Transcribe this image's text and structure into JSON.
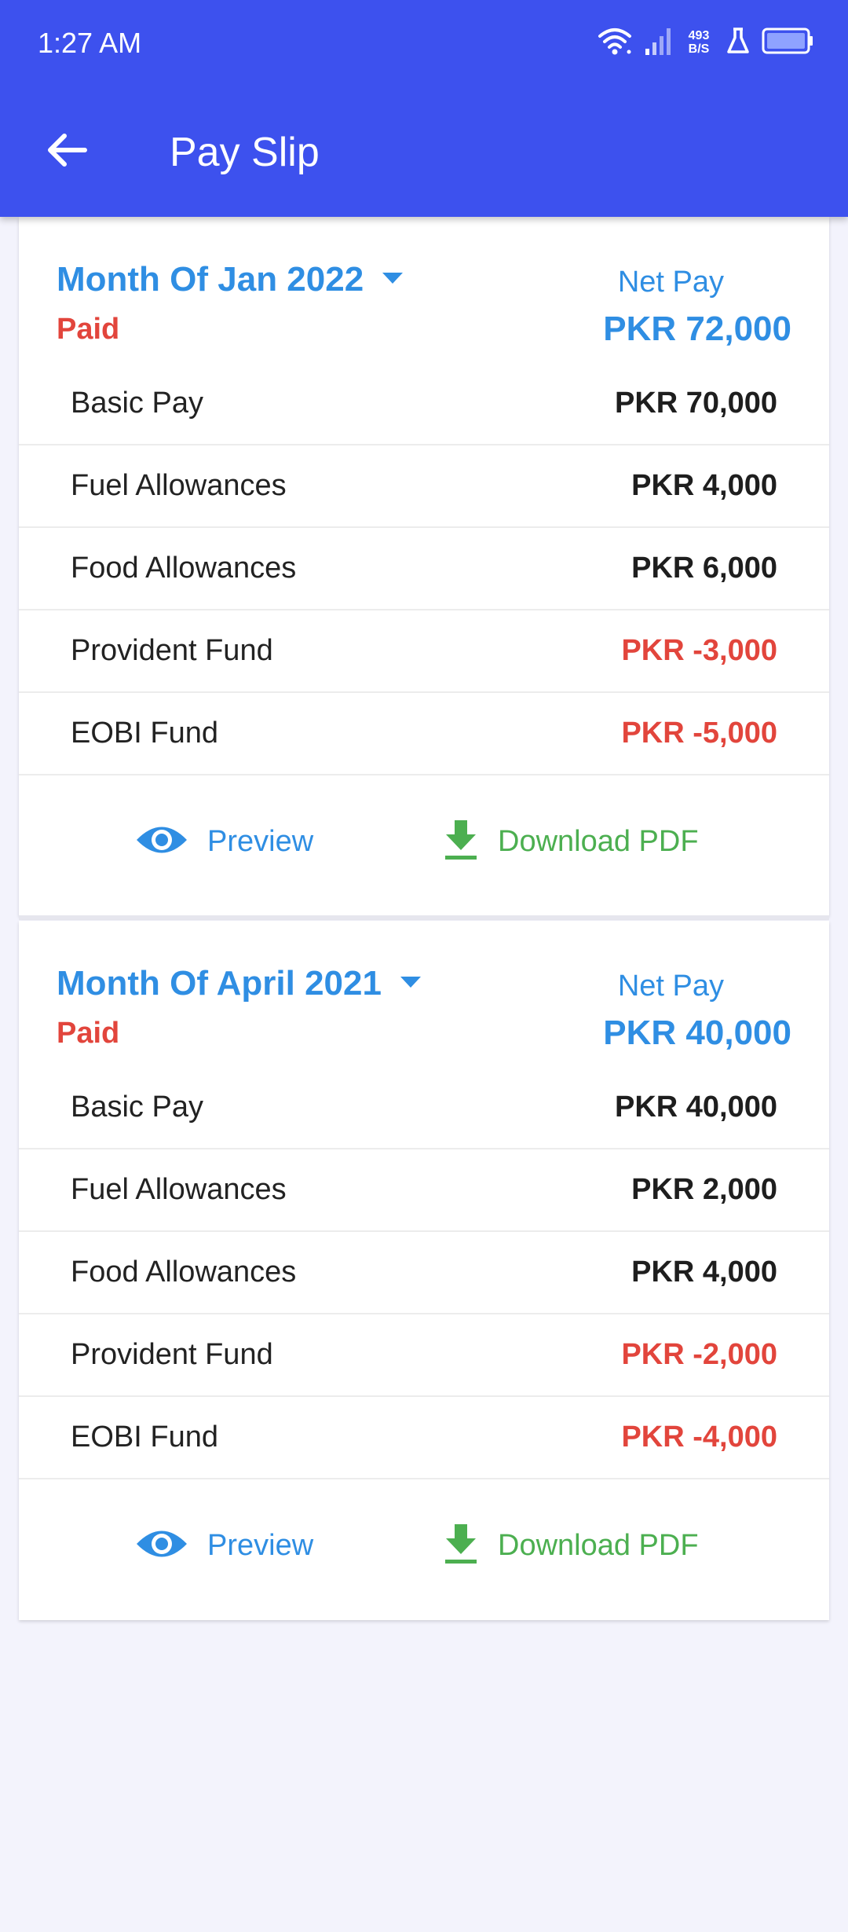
{
  "status_bar": {
    "time": "1:27 AM",
    "net_speed_value": "493",
    "net_speed_unit": "B/S"
  },
  "app_bar": {
    "title": "Pay Slip"
  },
  "payslips": [
    {
      "month": "Month Of Jan 2022",
      "status": "Paid",
      "net_pay_label": "Net Pay",
      "net_pay_value": "PKR 72,000",
      "items": [
        {
          "label": "Basic Pay",
          "value": "PKR 70,000"
        },
        {
          "label": "Fuel Allowances",
          "value": "PKR 4,000"
        },
        {
          "label": "Food Allowances",
          "value": "PKR 6,000"
        },
        {
          "label": "Provident Fund",
          "value": "PKR -3,000"
        },
        {
          "label": "EOBI Fund",
          "value": "PKR -5,000"
        }
      ],
      "preview_label": "Preview",
      "download_label": "Download PDF"
    },
    {
      "month": "Month Of April 2021",
      "status": "Paid",
      "net_pay_label": "Net Pay",
      "net_pay_value": "PKR 40,000",
      "items": [
        {
          "label": "Basic Pay",
          "value": "PKR 40,000"
        },
        {
          "label": "Fuel Allowances",
          "value": "PKR 2,000"
        },
        {
          "label": "Food Allowances",
          "value": "PKR 4,000"
        },
        {
          "label": "Provident Fund",
          "value": "PKR -2,000"
        },
        {
          "label": "EOBI Fund",
          "value": "PKR -4,000"
        }
      ],
      "preview_label": "Preview",
      "download_label": "Download PDF"
    }
  ],
  "colors": {
    "app_bar": "#3d51ee",
    "accent_blue": "#2f8ee3",
    "paid_red": "#e2453c",
    "download_green": "#4caf50",
    "background": "#f3f3fc"
  },
  "icons": [
    "back-arrow-icon",
    "wifi-icon",
    "signal-icon",
    "flask-icon",
    "battery-icon",
    "dropdown-caret-icon",
    "eye-icon",
    "download-icon"
  ]
}
